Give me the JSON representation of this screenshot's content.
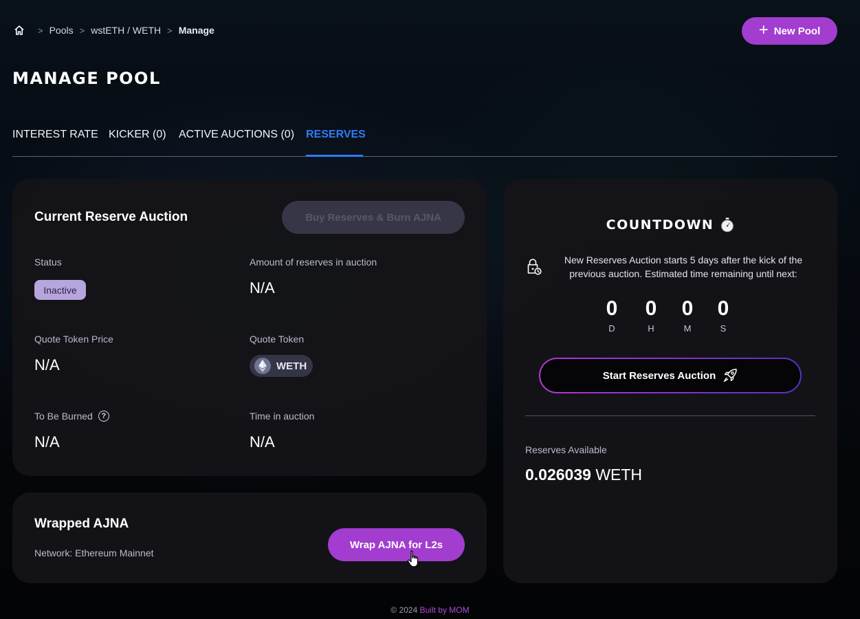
{
  "breadcrumb": {
    "home_icon": "home-icon",
    "items": [
      "Pools",
      "wstETH / WETH"
    ],
    "current": "Manage",
    "separator": ">"
  },
  "header": {
    "new_pool_label": "New Pool",
    "page_title": "MANAGE POOL"
  },
  "tabs": [
    {
      "label": "INTEREST RATE",
      "active": false
    },
    {
      "label": "KICKER (0)",
      "active": false
    },
    {
      "label": "ACTIVE AUCTIONS (0)",
      "active": false
    },
    {
      "label": "RESERVES",
      "active": true
    }
  ],
  "reserve_auction": {
    "title": "Current Reserve Auction",
    "buy_button_label": "Buy Reserves & Burn AJNA",
    "status_label": "Status",
    "status_value": "Inactive",
    "amount_label": "Amount of reserves in auction",
    "amount_value": "N/A",
    "quote_price_label": "Quote Token Price",
    "quote_price_value": "N/A",
    "quote_token_label": "Quote Token",
    "quote_token_symbol": "WETH",
    "burned_label": "To Be Burned",
    "burned_value": "N/A",
    "time_label": "Time in auction",
    "time_value": "N/A"
  },
  "wrapped": {
    "title": "Wrapped AJNA",
    "network": "Network: Ethereum Mainnet",
    "wrap_button_label": "Wrap AJNA for L2s"
  },
  "countdown": {
    "title": "COUNTDOWN",
    "description": "New Reserves Auction starts 5 days after the kick of the previous auction. Estimated time remaining until next:",
    "units": [
      {
        "value": "0",
        "unit": "D"
      },
      {
        "value": "0",
        "unit": "H"
      },
      {
        "value": "0",
        "unit": "M"
      },
      {
        "value": "0",
        "unit": "S"
      }
    ],
    "start_button_label": "Start Reserves Auction",
    "reserves_label": "Reserves Available",
    "reserves_amount": "0.026039",
    "reserves_symbol": "WETH"
  },
  "footer": {
    "copyright": "© 2024",
    "brand": "Built by MOM"
  },
  "colors": {
    "accent_purple": "#a23dd0",
    "active_tab_blue": "#2e7cf6",
    "status_badge": "#b7a6dd"
  }
}
